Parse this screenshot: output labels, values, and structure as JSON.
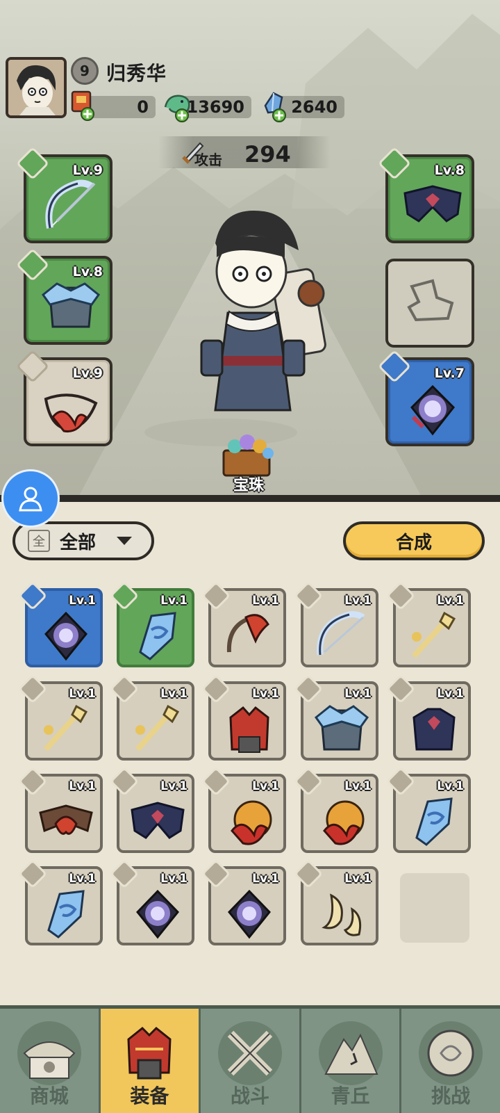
{
  "player": {
    "level": "9",
    "name": "归秀华"
  },
  "resources": [
    {
      "name": "red-ticket",
      "value": "0"
    },
    {
      "name": "jade",
      "value": "13690"
    },
    {
      "name": "crystal",
      "value": "2640"
    }
  ],
  "stats": {
    "attack_label": "攻击",
    "attack_value": "294"
  },
  "equipment": {
    "weapon": "Lv.9",
    "armor": "Lv.8",
    "necklace": "Lv.9",
    "belt": "Lv.8",
    "charm": "Lv.7"
  },
  "chest_label": "宝珠",
  "filter": {
    "icon": "全",
    "label": "全部"
  },
  "craft_label": "合成",
  "bag": {
    "items": [
      {
        "level": "Lv.1",
        "rarity": "blue",
        "kind": "charm"
      },
      {
        "level": "Lv.1",
        "rarity": "green",
        "kind": "crystal"
      },
      {
        "level": "Lv.1",
        "rarity": "tan",
        "kind": "flame-bow"
      },
      {
        "level": "Lv.1",
        "rarity": "tan",
        "kind": "ice-bow"
      },
      {
        "level": "Lv.1",
        "rarity": "tan",
        "kind": "staff"
      },
      {
        "level": "Lv.1",
        "rarity": "tan",
        "kind": "staff"
      },
      {
        "level": "Lv.1",
        "rarity": "tan",
        "kind": "staff"
      },
      {
        "level": "Lv.1",
        "rarity": "tan",
        "kind": "red-armor"
      },
      {
        "level": "Lv.1",
        "rarity": "tan",
        "kind": "ice-armor"
      },
      {
        "level": "Lv.1",
        "rarity": "tan",
        "kind": "dark-armor"
      },
      {
        "level": "Lv.1",
        "rarity": "tan",
        "kind": "red-belt"
      },
      {
        "level": "Lv.1",
        "rarity": "tan",
        "kind": "dark-belt"
      },
      {
        "level": "Lv.1",
        "rarity": "tan",
        "kind": "fire-orb"
      },
      {
        "level": "Lv.1",
        "rarity": "tan",
        "kind": "fire-orb"
      },
      {
        "level": "Lv.1",
        "rarity": "tan",
        "kind": "crystal"
      },
      {
        "level": "Lv.1",
        "rarity": "tan",
        "kind": "crystal"
      },
      {
        "level": "Lv.1",
        "rarity": "tan",
        "kind": "charm"
      },
      {
        "level": "Lv.1",
        "rarity": "tan",
        "kind": "charm"
      },
      {
        "level": "Lv.1",
        "rarity": "tan",
        "kind": "claw"
      }
    ]
  },
  "nav": [
    {
      "label": "商城",
      "icon": "shop-icon"
    },
    {
      "label": "装备",
      "icon": "equipment-icon",
      "active": true
    },
    {
      "label": "战斗",
      "icon": "battle-icon"
    },
    {
      "label": "青丘",
      "icon": "qingqiu-icon"
    },
    {
      "label": "挑战",
      "icon": "challenge-icon"
    }
  ],
  "colors": {
    "active_tab": "#f1c75c",
    "craft_button": "#f6c95a",
    "green_rarity": "#62a65a",
    "blue_rarity": "#3f79c9"
  }
}
